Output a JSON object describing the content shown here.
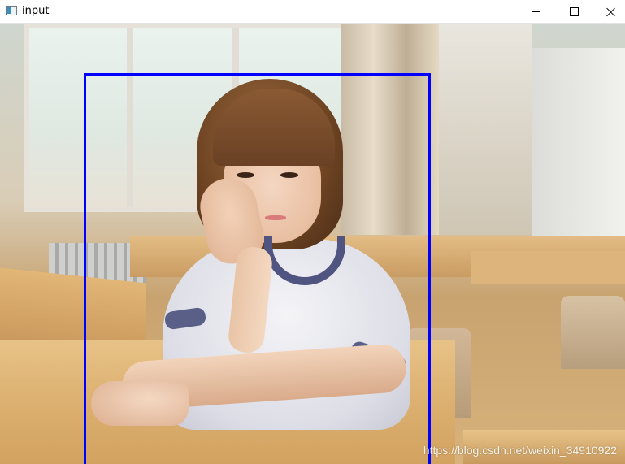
{
  "window": {
    "title": "input",
    "icon": "app-window-icon",
    "controls": {
      "minimize_icon": "minimize-icon",
      "maximize_icon": "maximize-icon",
      "close_icon": "close-icon"
    }
  },
  "image": {
    "watermark": "https://blog.csdn.net/weixin_34910922",
    "detection_box_color": "#0000ff"
  }
}
